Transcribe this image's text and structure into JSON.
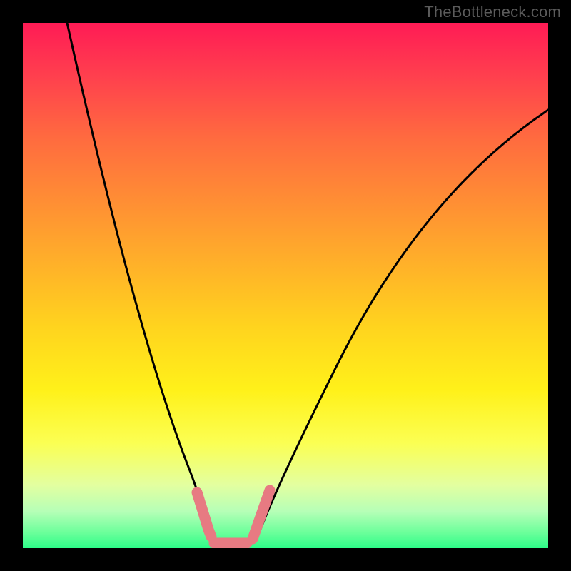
{
  "watermark": "TheBottleneck.com",
  "chart_data": {
    "type": "line",
    "title": "",
    "xlabel": "",
    "ylabel": "",
    "xlim": [
      0,
      100
    ],
    "ylim": [
      0,
      100
    ],
    "grid": false,
    "legend": false,
    "background_gradient": {
      "direction": "vertical",
      "stops": [
        {
          "pos": 0.0,
          "color": "#ff1b55"
        },
        {
          "pos": 0.1,
          "color": "#ff3f4e"
        },
        {
          "pos": 0.22,
          "color": "#ff6b3f"
        },
        {
          "pos": 0.34,
          "color": "#ff8e34"
        },
        {
          "pos": 0.46,
          "color": "#ffb129"
        },
        {
          "pos": 0.58,
          "color": "#ffd41e"
        },
        {
          "pos": 0.7,
          "color": "#fff11a"
        },
        {
          "pos": 0.8,
          "color": "#fbff53"
        },
        {
          "pos": 0.88,
          "color": "#e3ffa0"
        },
        {
          "pos": 0.93,
          "color": "#b6ffb7"
        },
        {
          "pos": 0.97,
          "color": "#6cff9b"
        },
        {
          "pos": 1.0,
          "color": "#2dfc88"
        }
      ]
    },
    "series": [
      {
        "name": "bottleneck_curve",
        "color": "#000000",
        "x": [
          8,
          12,
          16,
          20,
          24,
          28,
          32,
          34,
          36,
          38,
          40,
          42,
          44,
          46,
          50,
          56,
          62,
          70,
          80,
          90,
          100
        ],
        "y": [
          100,
          85,
          70,
          56,
          43,
          30,
          18,
          12,
          5,
          1,
          0,
          0,
          1,
          5,
          15,
          30,
          45,
          60,
          72,
          80,
          85
        ]
      },
      {
        "name": "highlight_region",
        "color": "#e77a82",
        "x": [
          33,
          34,
          35,
          36,
          37,
          38,
          40,
          42,
          43,
          44,
          45,
          46,
          47
        ],
        "y": [
          11,
          8,
          5,
          3,
          1,
          0,
          0,
          0,
          1,
          3,
          6,
          9,
          12
        ]
      }
    ],
    "annotations": [
      {
        "text": "TheBottleneck.com",
        "role": "watermark",
        "position": "top-right",
        "color": "#5b5b5b"
      }
    ]
  }
}
